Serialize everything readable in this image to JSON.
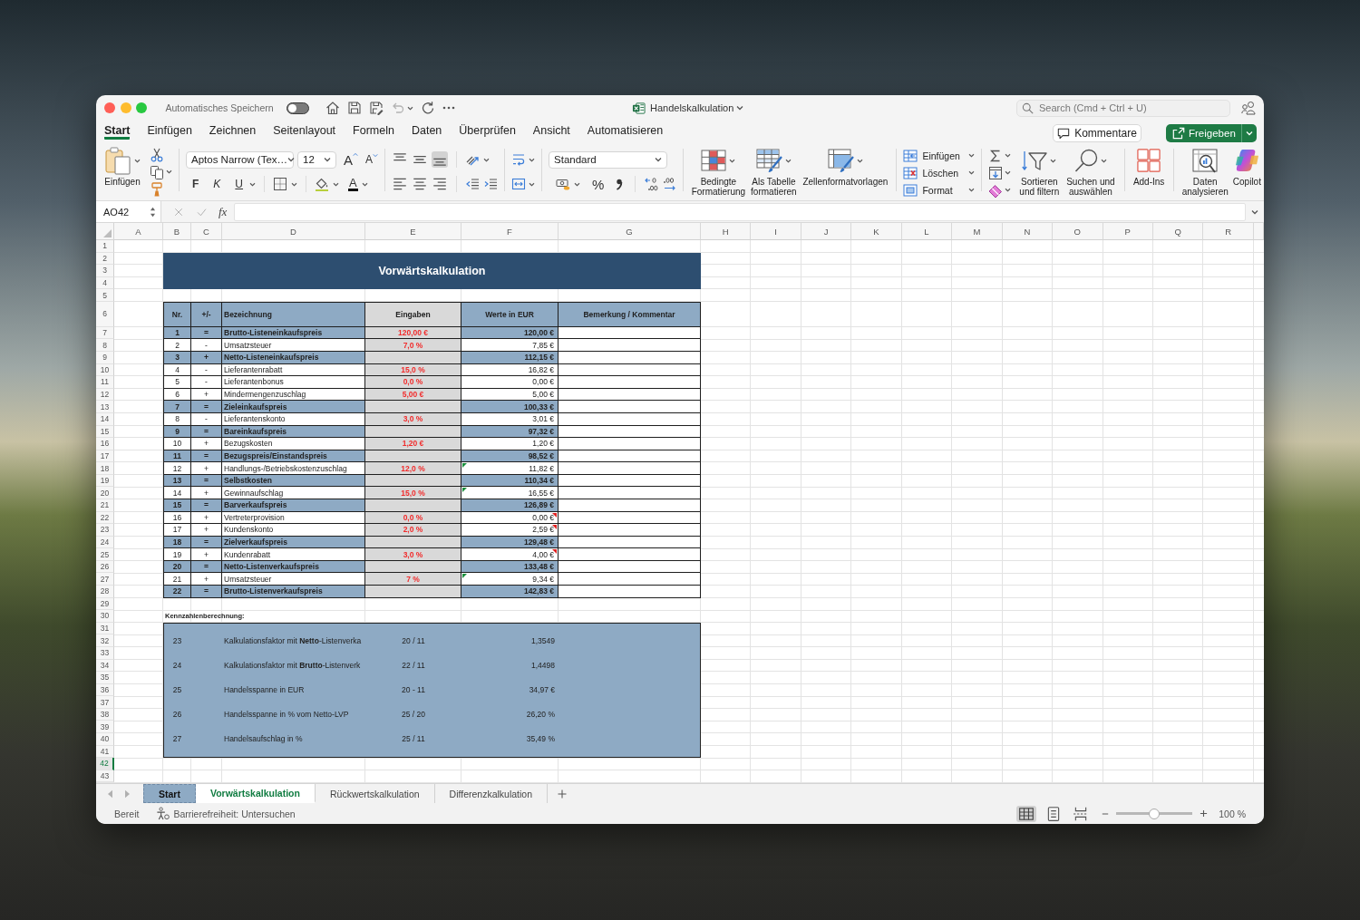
{
  "window": {
    "autosave_label": "Automatisches Speichern",
    "autosave_on": false,
    "title": "Handelskalkulation",
    "search_placeholder": "Search (Cmd + Ctrl + U)"
  },
  "ribbon_tabs": [
    {
      "label": "Start",
      "selected": true
    },
    {
      "label": "Einfügen",
      "selected": false
    },
    {
      "label": "Zeichnen",
      "selected": false
    },
    {
      "label": "Seitenlayout",
      "selected": false
    },
    {
      "label": "Formeln",
      "selected": false
    },
    {
      "label": "Daten",
      "selected": false
    },
    {
      "label": "Überprüfen",
      "selected": false
    },
    {
      "label": "Ansicht",
      "selected": false
    },
    {
      "label": "Automatisieren",
      "selected": false
    }
  ],
  "header_buttons": {
    "comments": "Kommentare",
    "share": "Freigeben"
  },
  "ribbon": {
    "paste_label": "Einfügen",
    "font_name": "Aptos Narrow (Tex…",
    "font_size": "12",
    "grow_font": "A",
    "shrink_font": "A",
    "bold": "F",
    "italic": "K",
    "underline": "U",
    "font_color": "A",
    "vertical_alignment": [
      {
        "kind": "top",
        "selected": false
      },
      {
        "kind": "middle",
        "selected": false
      },
      {
        "kind": "bottom",
        "selected": true
      }
    ],
    "number_format": "Standard",
    "percent": "%",
    "style_buttons": [
      {
        "kind": "conditional",
        "label": "Bedingte Formatierung"
      },
      {
        "kind": "table",
        "label": "Als Tabelle formatieren"
      },
      {
        "kind": "cellstyles",
        "label": "Zellenformatvorlagen"
      }
    ],
    "cell_buttons": [
      {
        "kind": "insert",
        "label": "Einfügen"
      },
      {
        "kind": "delete",
        "label": "Löschen"
      },
      {
        "kind": "format",
        "label": "Format"
      }
    ],
    "sort_label": "Sortieren und filtern",
    "find_label": "Suchen und auswählen",
    "addins_label": "Add-Ins",
    "analyze_label": "Daten analysieren",
    "copilot_label": "Copilot"
  },
  "formula_bar": {
    "name_box": "AO42",
    "fx": "fx"
  },
  "sheet": {
    "columns": [
      "A",
      "B",
      "C",
      "D",
      "E",
      "F",
      "G",
      "H",
      "I",
      "J",
      "K",
      "L",
      "M",
      "N",
      "O",
      "P",
      "Q",
      "R"
    ],
    "rows": [
      {
        "label": "1",
        "selected": false
      },
      {
        "label": "2",
        "selected": false
      },
      {
        "label": "3",
        "selected": false
      },
      {
        "label": "4",
        "selected": false
      },
      {
        "label": "5",
        "selected": false
      },
      {
        "label": "6",
        "selected": false
      },
      {
        "label": "7",
        "selected": false
      },
      {
        "label": "8",
        "selected": false
      },
      {
        "label": "9",
        "selected": false
      },
      {
        "label": "10",
        "selected": false
      },
      {
        "label": "11",
        "selected": false
      },
      {
        "label": "12",
        "selected": false
      },
      {
        "label": "13",
        "selected": false
      },
      {
        "label": "14",
        "selected": false
      },
      {
        "label": "15",
        "selected": false
      },
      {
        "label": "16",
        "selected": false
      },
      {
        "label": "17",
        "selected": false
      },
      {
        "label": "18",
        "selected": false
      },
      {
        "label": "19",
        "selected": false
      },
      {
        "label": "20",
        "selected": false
      },
      {
        "label": "21",
        "selected": false
      },
      {
        "label": "22",
        "selected": false
      },
      {
        "label": "23",
        "selected": false
      },
      {
        "label": "24",
        "selected": false
      },
      {
        "label": "25",
        "selected": false
      },
      {
        "label": "26",
        "selected": false
      },
      {
        "label": "27",
        "selected": false
      },
      {
        "label": "28",
        "selected": false
      },
      {
        "label": "29",
        "selected": false
      },
      {
        "label": "30",
        "selected": false
      },
      {
        "label": "31",
        "selected": false
      },
      {
        "label": "32",
        "selected": false
      },
      {
        "label": "33",
        "selected": false
      },
      {
        "label": "34",
        "selected": false
      },
      {
        "label": "35",
        "selected": false
      },
      {
        "label": "36",
        "selected": false
      },
      {
        "label": "37",
        "selected": false
      },
      {
        "label": "38",
        "selected": false
      },
      {
        "label": "39",
        "selected": false
      },
      {
        "label": "40",
        "selected": false
      },
      {
        "label": "41",
        "selected": false
      },
      {
        "label": "42",
        "selected": true
      },
      {
        "label": "43",
        "selected": false
      }
    ],
    "title": "Vorwärtskalkulation",
    "headers": [
      "Nr.",
      "+/-",
      "Bezeichnung",
      "Eingaben",
      "Werte in EUR",
      "Bemerkung / Kommentar"
    ],
    "lines": [
      {
        "nr": "1",
        "sign": "=",
        "name": "Brutto-Listeneinkaufspreis",
        "input": "120,00 €",
        "value": "120,00 €",
        "kind": "total",
        "error_flag": false,
        "comment_flag": false
      },
      {
        "nr": "2",
        "sign": "-",
        "name": "Umsatzsteuer",
        "input": "7,0 %",
        "value": "7,85 €",
        "kind": "item",
        "error_flag": false,
        "comment_flag": false
      },
      {
        "nr": "3",
        "sign": "+",
        "name": "Netto-Listeneinkaufspreis",
        "value": "112,15 €",
        "kind": "total",
        "error_flag": false,
        "comment_flag": false
      },
      {
        "nr": "4",
        "sign": "-",
        "name": "Lieferantenrabatt",
        "input": "15,0 %",
        "value": "16,82 €",
        "kind": "item",
        "error_flag": false,
        "comment_flag": false
      },
      {
        "nr": "5",
        "sign": "-",
        "name": "Lieferantenbonus",
        "input": "0,0 %",
        "value": "0,00 €",
        "kind": "item",
        "error_flag": false,
        "comment_flag": false
      },
      {
        "nr": "6",
        "sign": "+",
        "name": "Mindermengenzuschlag",
        "input": "5,00 €",
        "value": "5,00 €",
        "kind": "item",
        "error_flag": false,
        "comment_flag": false
      },
      {
        "nr": "7",
        "sign": "=",
        "name": "Zieleinkaufspreis",
        "value": "100,33 €",
        "kind": "total",
        "error_flag": false,
        "comment_flag": false
      },
      {
        "nr": "8",
        "sign": "-",
        "name": "Lieferantenskonto",
        "input": "3,0 %",
        "value": "3,01 €",
        "kind": "item",
        "error_flag": false,
        "comment_flag": false
      },
      {
        "nr": "9",
        "sign": "=",
        "name": "Bareinkaufspreis",
        "value": "97,32 €",
        "kind": "total",
        "error_flag": false,
        "comment_flag": false
      },
      {
        "nr": "10",
        "sign": "+",
        "name": "Bezugskosten",
        "input": "1,20 €",
        "value": "1,20 €",
        "kind": "item",
        "error_flag": false,
        "comment_flag": false
      },
      {
        "nr": "11",
        "sign": "=",
        "name": "Bezugspreis/Einstandspreis",
        "value": "98,52 €",
        "kind": "total",
        "error_flag": false,
        "comment_flag": false
      },
      {
        "nr": "12",
        "sign": "+",
        "name": "Handlungs-/Betriebskostenzuschlag",
        "input": "12,0 %",
        "value": "11,82 €",
        "kind": "item",
        "error_flag": true,
        "comment_flag": false
      },
      {
        "nr": "13",
        "sign": "=",
        "name": "Selbstkosten",
        "value": "110,34 €",
        "kind": "total",
        "error_flag": false,
        "comment_flag": false
      },
      {
        "nr": "14",
        "sign": "+",
        "name": "Gewinnaufschlag",
        "input": "15,0 %",
        "value": "16,55 €",
        "kind": "item",
        "error_flag": true,
        "comment_flag": false
      },
      {
        "nr": "15",
        "sign": "=",
        "name": "Barverkaufspreis",
        "value": "126,89 €",
        "kind": "total",
        "error_flag": false,
        "comment_flag": false
      },
      {
        "nr": "16",
        "sign": "+",
        "name": "Vertreterprovision",
        "input": "0,0 %",
        "value": "0,00 €",
        "kind": "item",
        "error_flag": false,
        "comment_flag": true
      },
      {
        "nr": "17",
        "sign": "+",
        "name": "Kundenskonto",
        "input": "2,0 %",
        "value": "2,59 €",
        "kind": "item",
        "error_flag": false,
        "comment_flag": true
      },
      {
        "nr": "18",
        "sign": "=",
        "name": "Zielverkaufspreis",
        "value": "129,48 €",
        "kind": "total",
        "error_flag": false,
        "comment_flag": false
      },
      {
        "nr": "19",
        "sign": "+",
        "name": "Kundenrabatt",
        "input": "3,0 %",
        "value": "4,00 €",
        "kind": "item",
        "error_flag": false,
        "comment_flag": true
      },
      {
        "nr": "20",
        "sign": "=",
        "name": "Netto-Listenverkaufspreis",
        "value": "133,48 €",
        "kind": "total",
        "error_flag": false,
        "comment_flag": false
      },
      {
        "nr": "21",
        "sign": "+",
        "name": "Umsatzsteuer",
        "input": "7 %",
        "value": "9,34 €",
        "kind": "item",
        "error_flag": true,
        "comment_flag": false
      },
      {
        "nr": "22",
        "sign": "=",
        "name": "Brutto-Listenverkaufspreis",
        "value": "142,83 €",
        "kind": "total",
        "error_flag": false,
        "comment_flag": false
      }
    ],
    "ratios_label": "Kennzahlenberechnung:",
    "ratios": [
      {
        "nr": "23",
        "name": "Kalkulationsfaktor mit **Netto**-Listenverka",
        "formula": "20 / 11",
        "value": "1,3549"
      },
      {
        "nr": "24",
        "name": "Kalkulationsfaktor mit **Brutto**-Listenverk",
        "formula": "22 / 11",
        "value": "1,4498"
      },
      {
        "nr": "25",
        "name": "Handelsspanne in EUR",
        "formula": "20 - 11",
        "value": "34,97 €"
      },
      {
        "nr": "26",
        "name": "Handelsspanne in % vom Netto-LVP",
        "formula": "25 / 20",
        "value": "26,20 %"
      },
      {
        "nr": "27",
        "name": "Handelsaufschlag in %",
        "formula": "25 / 11",
        "value": "35,49 %"
      }
    ]
  },
  "sheet_tabs": [
    {
      "label": "Start",
      "selected": false,
      "color": "#8eaac4"
    },
    {
      "label": "Vorwärtskalkulation",
      "selected": true
    },
    {
      "label": "Rückwertskalkulation",
      "selected": false
    },
    {
      "label": "Differenzkalkulation",
      "selected": false
    }
  ],
  "status_bar": {
    "ready": "Bereit",
    "accessibility": "Barrierefreiheit: Untersuchen",
    "views": [
      {
        "kind": "normal",
        "selected": true
      },
      {
        "kind": "page_layout",
        "selected": false
      },
      {
        "kind": "page_break",
        "selected": false
      }
    ],
    "zoom": {
      "level": 0.5,
      "label": "100 %"
    }
  }
}
